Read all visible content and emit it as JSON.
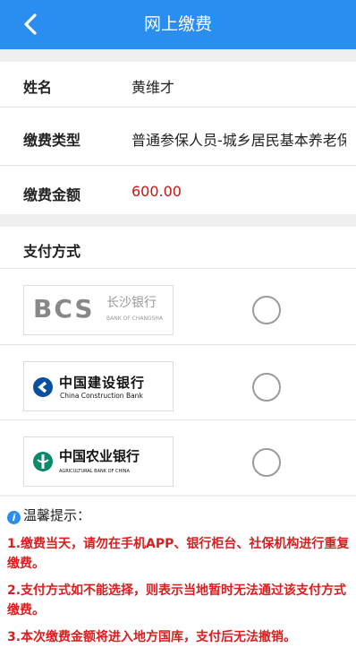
{
  "header": {
    "title": "网上缴费"
  },
  "info": {
    "name_label": "姓名",
    "name_value": "黄维才",
    "type_label": "缴费类型",
    "type_value": "普通参保人员-城乡居民基本养老保险",
    "amount_label": "缴费金额",
    "amount_value": "600.00"
  },
  "payment": {
    "label": "支付方式",
    "banks": [
      {
        "name": "长沙银行",
        "sub": "BANK OF CHANGSHA",
        "mark": "BCS"
      },
      {
        "name": "中国建设银行",
        "sub": "China Construction Bank"
      },
      {
        "name": "中国农业银行",
        "sub": "AGRICULTURAL BANK OF CHINA"
      }
    ]
  },
  "tips": {
    "title": "温馨提示：",
    "items": [
      "1.缴费当天，请勿在手机APP、银行柜台、社保机构进行重复缴费。",
      "2.支付方式如不能选择，则表示当地暂时无法通过该支付方式缴费。",
      "3.本次缴费金额将进入地方国库，支付后无法撤销。"
    ]
  },
  "colors": {
    "header": "#2a8df0",
    "amount": "#c81414",
    "tips": "#d81e1e"
  },
  "icons": {
    "back": "chevron-left-icon",
    "info": "info-icon"
  }
}
